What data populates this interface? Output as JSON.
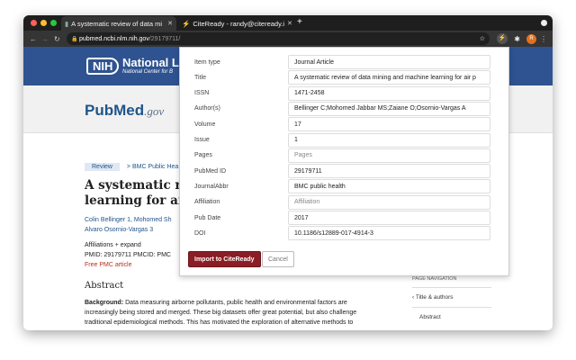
{
  "browser": {
    "tabs": [
      {
        "title": "A systematic review of data mi"
      },
      {
        "title": "CiteReady - randy@citeready.i"
      }
    ],
    "url_host": "pubmed.ncbi.nlm.nih.gov",
    "url_path": "/29179711/",
    "profile_initial": "R"
  },
  "header": {
    "nih_logo": "NIH",
    "nih_title": "National Lib",
    "nih_subtitle": "National Center for B",
    "pubmed_logo": "PubMed",
    "pubmed_suffix": ".gov"
  },
  "article": {
    "badge": "Review",
    "journal": "> BMC Public Hea",
    "title_line1": "A systematic revi",
    "title_line2": "learning for air p",
    "authors_line1": "Colin Bellinger 1, Mohomed Sh",
    "authors_line2": "Alvaro Osornio-Vargas 3",
    "affiliations": "Affiliations  + expand",
    "ids": "PMID: 29179711   PMCID: PMC",
    "free": "Free PMC article",
    "abstract_heading": "Abstract",
    "abstract_label": "Background:",
    "abstract_text": " Data measuring airborne pollutants, public health and environmental factors are increasingly being stored and merged. These big datasets offer great potential, but also challenge traditional epidemiological methods. This has motivated the exploration of alternative methods to"
  },
  "page_nav": {
    "heading": "PAGE NAVIGATION",
    "items": [
      "Title & authors",
      "Abstract"
    ]
  },
  "popup": {
    "fields": [
      {
        "label": "Item type",
        "value": "Journal Article"
      },
      {
        "label": "Title",
        "value": "A systematic review of data mining and machine learning for air p"
      },
      {
        "label": "ISSN",
        "value": "1471-2458"
      },
      {
        "label": "Author(s)",
        "value": "Bellinger C;Mohomed Jabbar MS;Zaiane O;Osornio-Vargas A"
      },
      {
        "label": "Volume",
        "value": "17"
      },
      {
        "label": "Issue",
        "value": "1"
      },
      {
        "label": "Pages",
        "placeholder": "Pages"
      },
      {
        "label": "PubMed ID",
        "value": "29179711"
      },
      {
        "label": "JournalAbbr",
        "value": "BMC public health"
      },
      {
        "label": "Affiliation",
        "placeholder": "Affiliation"
      },
      {
        "label": "Pub Date",
        "value": "2017"
      },
      {
        "label": "DOI",
        "value": "10.1186/s12889-017-4914-3"
      }
    ],
    "import_label": "Import to CiteReady",
    "cancel_label": "Cancel"
  }
}
